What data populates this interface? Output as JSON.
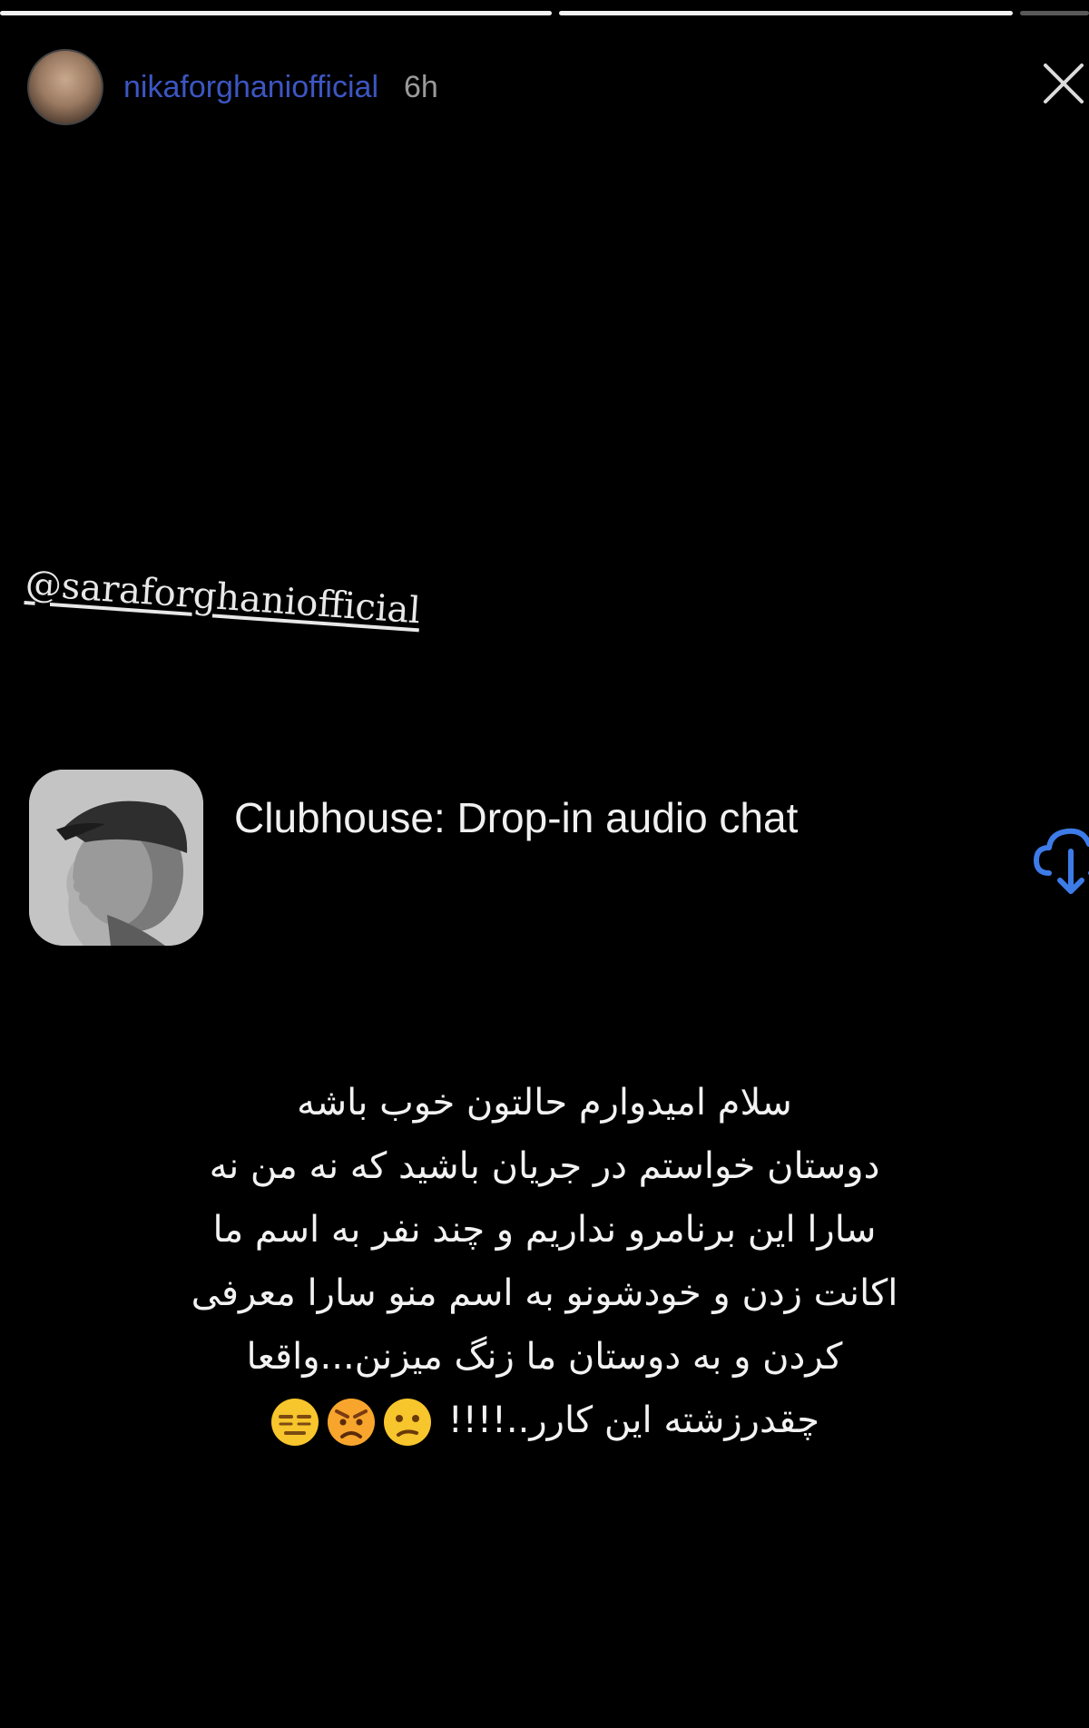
{
  "story": {
    "progress": [
      1.0,
      1.0,
      0.0
    ]
  },
  "header": {
    "username": "nikaforghaniofficial",
    "time": "6h",
    "close_icon": "close-icon"
  },
  "mention": {
    "text": "@saraforghaniofficial"
  },
  "app_card": {
    "title": "Clubhouse: Drop-in audio chat",
    "icon": "clubhouse-app-icon",
    "download_icon": "cloud-download-icon",
    "accent": "#3d7be8"
  },
  "caption": {
    "lines": [
      "سلام امیدوارم حالتون خوب باشه",
      "دوستان خواستم در جریان باشید که نه من نه",
      "سارا  این برنامرو نداریم و چند نفر به اسم ما",
      "اکانت زدن و خودشونو به اسم منو سارا معرفی",
      "کردن و به دوستان ما زنگ میزنن...واقعا",
      "چقدرزشته این کارر..!!!!"
    ],
    "emojis": [
      "confused-face-emoji",
      "angry-face-emoji",
      "expressionless-face-emoji"
    ]
  }
}
